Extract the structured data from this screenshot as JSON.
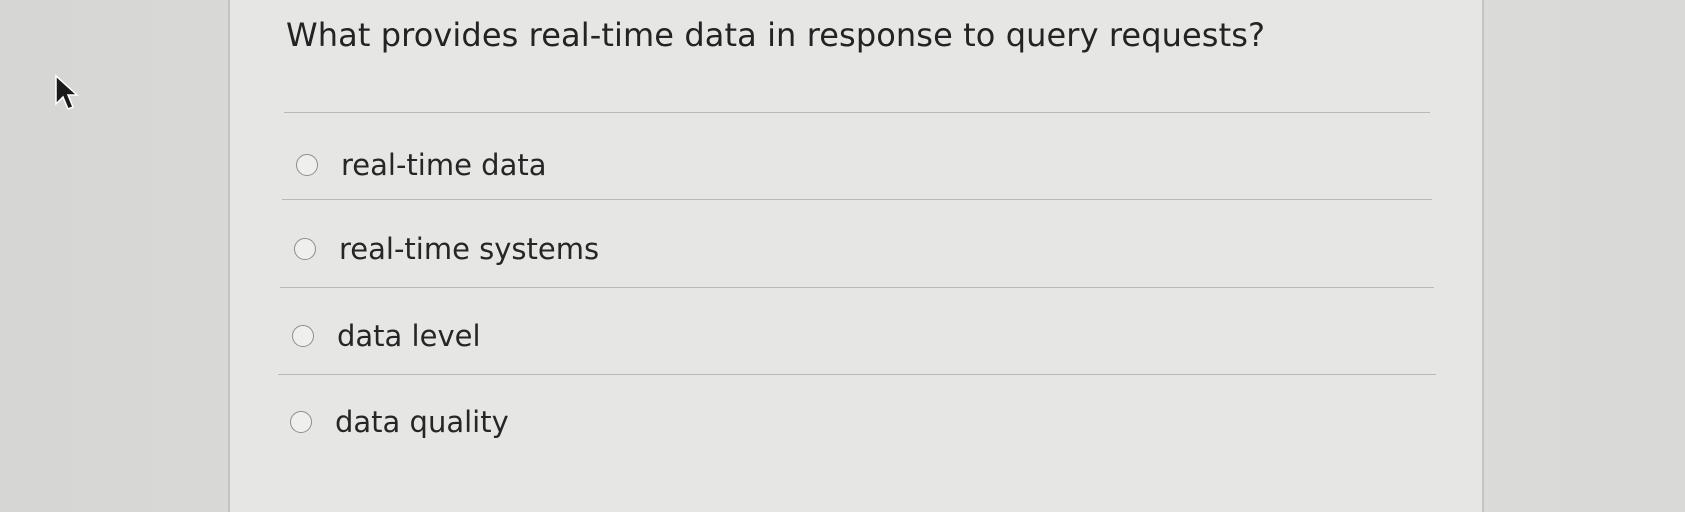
{
  "question": {
    "text": "What provides real-time data in response to query requests?"
  },
  "options": [
    {
      "label": "real-time data",
      "selected": false
    },
    {
      "label": "real-time systems",
      "selected": false
    },
    {
      "label": "data level",
      "selected": false
    },
    {
      "label": "data quality",
      "selected": false
    }
  ],
  "icons": {
    "cursor": "mouse-pointer-icon"
  }
}
